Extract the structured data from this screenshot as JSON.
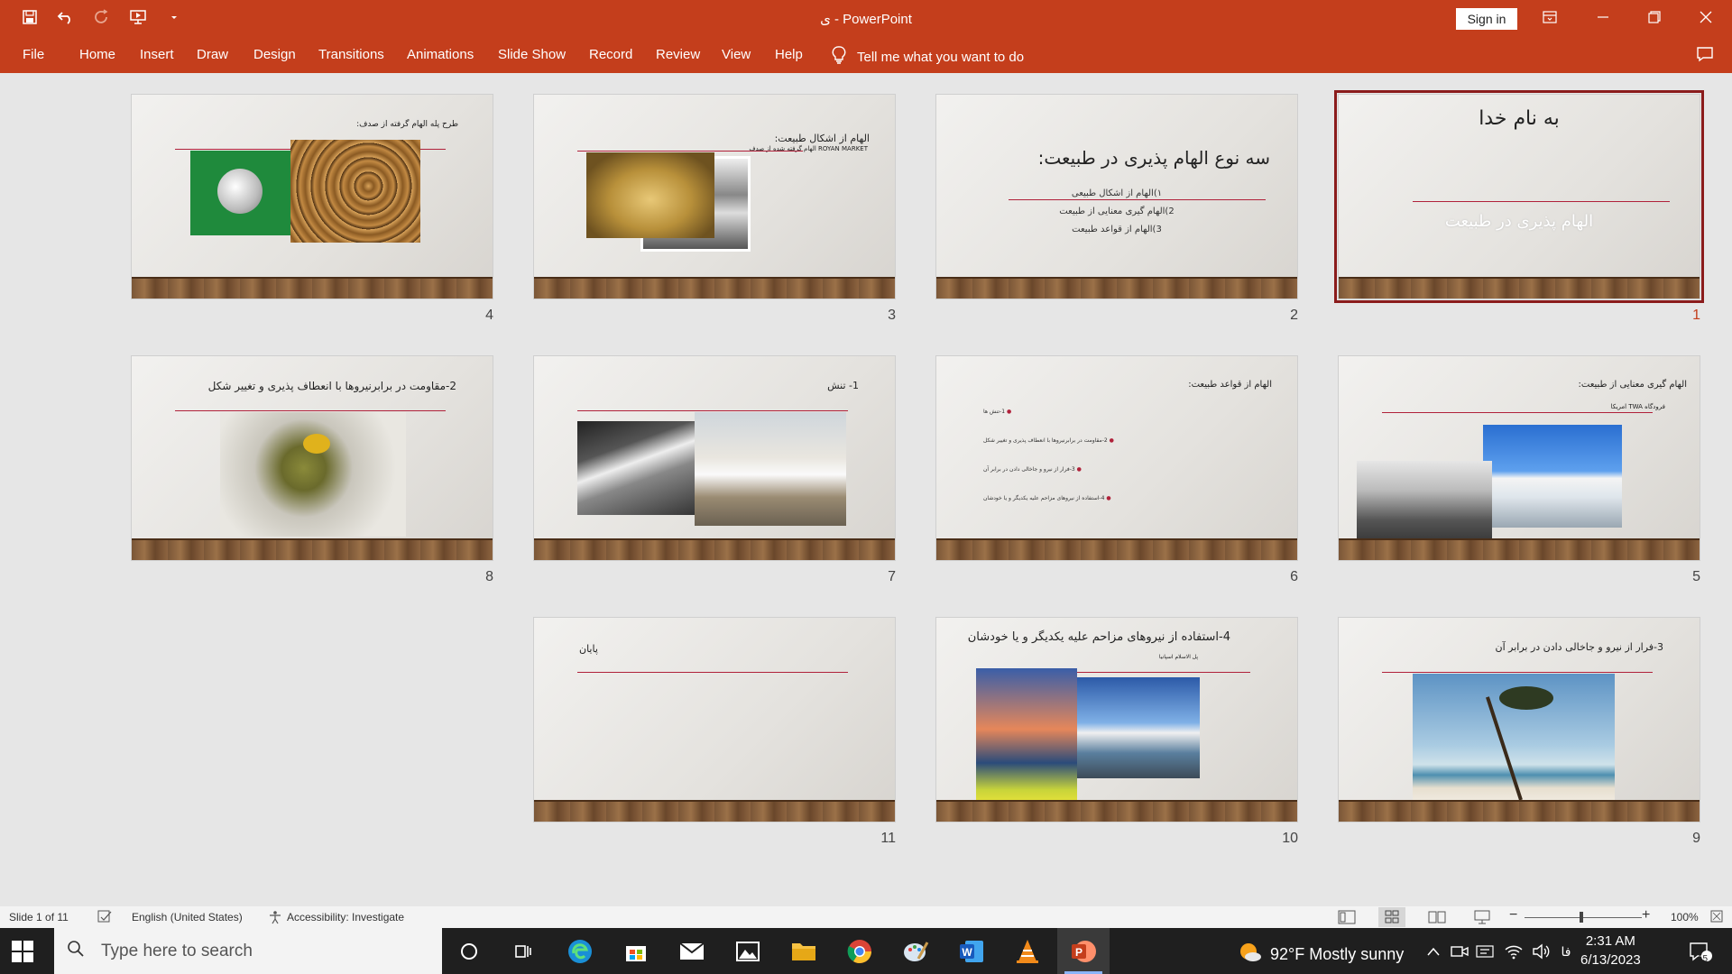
{
  "window": {
    "title": "ی  -  PowerPoint",
    "sign_in": "Sign in"
  },
  "ribbon": {
    "tabs": [
      "File",
      "Home",
      "Insert",
      "Draw",
      "Design",
      "Transitions",
      "Animations",
      "Slide Show",
      "Record",
      "Review",
      "View",
      "Help"
    ],
    "tell_me": "Tell me what you want to do"
  },
  "slides": [
    {
      "num": "1",
      "title": "به نام خدا",
      "subtitle": "الهام پذیری در طبیعت"
    },
    {
      "num": "2",
      "title": "سه نوع الهام پذیری در طبیعت:",
      "bullets": [
        "۱)الهام از اشکال طبیعی",
        "2)الهام گیری معنایی از طبیعت",
        "3)الهام از قواعد طبیعت"
      ]
    },
    {
      "num": "3",
      "title": "الهام از اشکال طبیعت:",
      "caption": "ROYAN MARKET   الهام گرفته شده از صدف"
    },
    {
      "num": "4",
      "title": "طرح پله الهام گرفته از صدف:"
    },
    {
      "num": "5",
      "title": "الهام گیری معنایی از طبیعت:",
      "caption": "فرودگاه TWA امریکا"
    },
    {
      "num": "6",
      "title": "الهام از قواعد طبیعت:",
      "bullets": [
        "1-تنش ها",
        "2-مقاومت در برابرنیروها با انعطاف پذیری و تغییر شکل",
        "3-فرار از نیرو و جاخالی دادن در برابر آن",
        "4-استفاده از نیروهای مزاحم علیه یکدیگر و یا خودشان"
      ]
    },
    {
      "num": "7",
      "title": "1- تنش"
    },
    {
      "num": "8",
      "title": "2-مقاومت در برابرنیروها با انعطاف پذیری و تغییر شکل"
    },
    {
      "num": "9",
      "title": "3-فرار از نیرو و جاخالی دادن در برابر آن"
    },
    {
      "num": "10",
      "title": "4-استفاده از نیروهای مزاحم علیه یکدیگر و یا خودشان",
      "caption": "پل الاسلام اسپانیا"
    },
    {
      "num": "11",
      "title": "پایان"
    }
  ],
  "status": {
    "slide_info": "Slide 1 of 11",
    "language": "English (United States)",
    "accessibility": "Accessibility: Investigate",
    "zoom": "100%"
  },
  "taskbar": {
    "search_placeholder": "Type here to search",
    "weather": "92°F  Mostly sunny",
    "lang": "فا",
    "time": "2:31 AM",
    "date": "6/13/2023",
    "notifications": "15"
  },
  "colors": {
    "accent": "#c43e1c",
    "rule": "#b0213a",
    "selected_outline": "#8b1c1c"
  }
}
